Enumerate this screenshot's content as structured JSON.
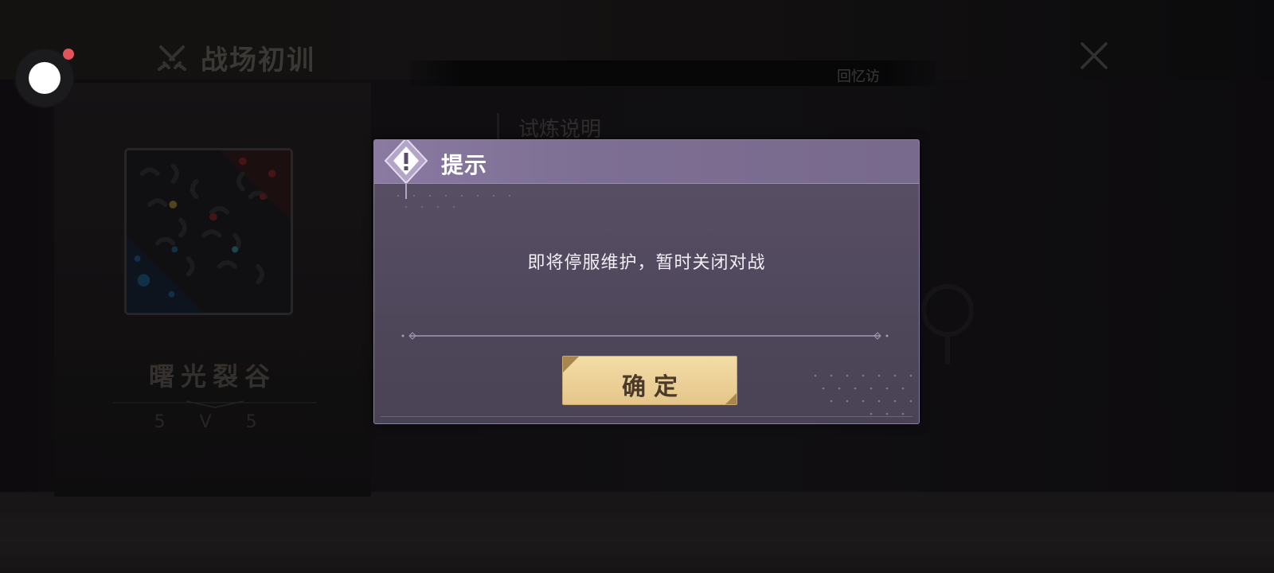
{
  "header": {
    "title": "战场初训",
    "memory_label": "回忆访",
    "title_icon": "crossed-swords-icon",
    "close_icon": "close-icon"
  },
  "map_card": {
    "name": "曙光裂谷",
    "mode": "5 V 5"
  },
  "trial": {
    "label": "试炼说明"
  },
  "dialog": {
    "title": "提示",
    "icon": "warning-icon",
    "message": "即将停服维护，暂时关闭对战",
    "confirm_label": "确定"
  },
  "colors": {
    "dialog_header": "#8a7aa2",
    "dialog_body": "#544b60",
    "confirm_button": "#ecd198",
    "notify_dot": "#e2535c"
  }
}
